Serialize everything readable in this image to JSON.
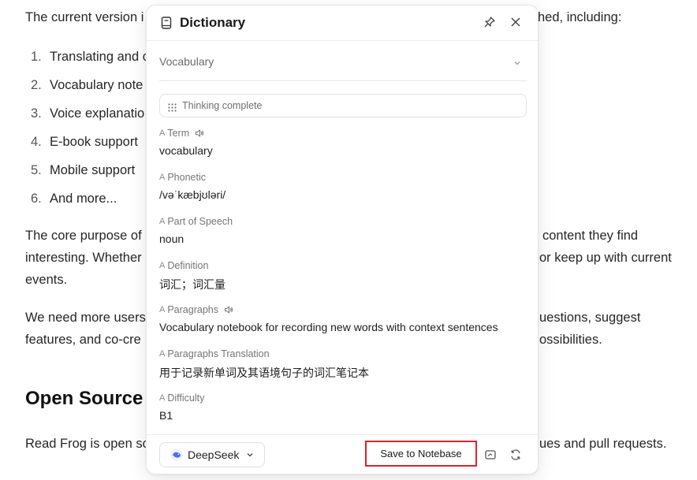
{
  "article": {
    "intro_start": "The current version i",
    "intro_end": "hed, including:",
    "list": [
      {
        "num": "1.",
        "text": "Translating and c"
      },
      {
        "num": "2.",
        "text": "Vocabulary note"
      },
      {
        "num": "3.",
        "text": "Voice explanatio"
      },
      {
        "num": "4.",
        "text": "E-book support"
      },
      {
        "num": "5.",
        "text": "Mobile support"
      },
      {
        "num": "6.",
        "text": "And more..."
      }
    ],
    "core": {
      "l1a": "The core purpose of",
      "l1b": "content they find",
      "l2a": "interesting. Whether",
      "l2b": "or keep up with current",
      "l3": "events."
    },
    "more": {
      "l1a": "We need more users",
      "l1b": "uestions, suggest",
      "l2a": "features, and co-cre",
      "l2b": "ossibilities."
    },
    "heading": "Open Source",
    "last": {
      "a": "Read Frog is open so",
      "b": "ues and pull requests."
    }
  },
  "panel": {
    "title": "Dictionary",
    "select_value": "Vocabulary",
    "thinking": "Thinking complete",
    "fields": [
      {
        "label": "Term",
        "value": "vocabulary"
      },
      {
        "label": "Phonetic",
        "value": "/vəˈkæbjʊləri/"
      },
      {
        "label": "Part of Speech",
        "value": "noun"
      },
      {
        "label": "Definition",
        "value": "词汇；词汇量"
      },
      {
        "label": "Paragraphs",
        "value": "Vocabulary notebook for recording new words with context sentences"
      },
      {
        "label": "Paragraphs Translation",
        "value": "用于记录新单词及其语境句子的词汇笔记本"
      },
      {
        "label": "Difficulty",
        "value": "B1"
      }
    ],
    "field_icon": "A",
    "model": "DeepSeek",
    "save_label": "Save to Notebase",
    "colors": {
      "save_border": "#d9232f",
      "deepseek_blue": "#4d6bfe"
    }
  }
}
